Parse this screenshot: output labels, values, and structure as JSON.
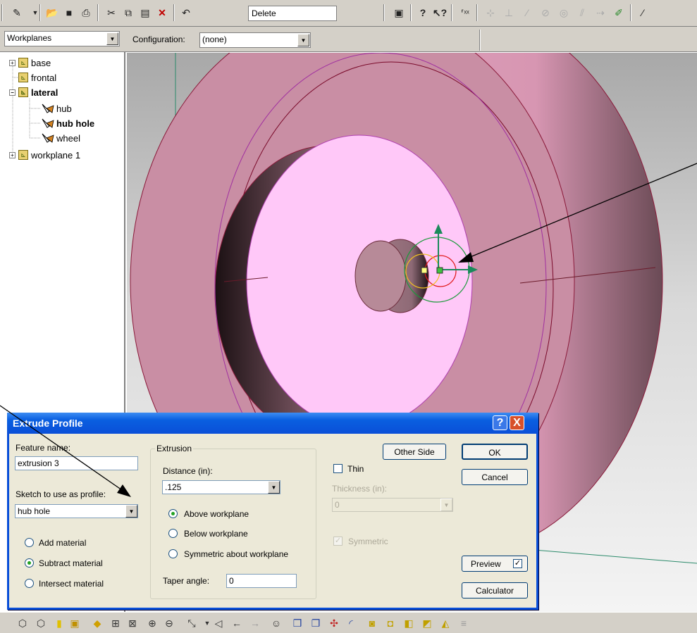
{
  "toolbar": {
    "delete_field": "Delete",
    "icons": [
      "sketch-icon",
      "open-icon",
      "save-icon",
      "print-icon",
      "cut-icon",
      "copy-icon",
      "paste-icon",
      "delete-icon",
      "undo-icon",
      "help-icon",
      "whats-this-icon"
    ]
  },
  "subbar": {
    "workplanes_value": "Workplanes",
    "configuration_label": "Configuration:",
    "configuration_value": "(none)"
  },
  "tree": {
    "items": [
      {
        "label": "base",
        "expander": "+"
      },
      {
        "label": "frontal",
        "expander": ""
      },
      {
        "label": "lateral",
        "expander": "−",
        "bold": true
      },
      {
        "label": "hub"
      },
      {
        "label": "hub hole",
        "bold": true
      },
      {
        "label": "wheel"
      },
      {
        "label": "workplane 1",
        "expander": "+"
      }
    ]
  },
  "dialog": {
    "title": "Extrude Profile",
    "feature_name_label": "Feature name:",
    "feature_name_value": "extrusion 3",
    "sketch_label": "Sketch to use as profile:",
    "sketch_value": "hub hole",
    "material_options": [
      "Add material",
      "Subtract material",
      "Intersect material"
    ],
    "material_selected": "Subtract material",
    "extrusion_group": "Extrusion",
    "distance_label": "Distance (in):",
    "distance_value": ".125",
    "direction_options": [
      "Above workplane",
      "Below workplane",
      "Symmetric about workplane"
    ],
    "direction_selected": "Above workplane",
    "taper_label": "Taper angle:",
    "taper_value": "0",
    "other_side_label": "Other Side",
    "thin_label": "Thin",
    "thin_checked": false,
    "thickness_label": "Thickness (in):",
    "thickness_value": "0",
    "symmetric_label": "Symmetric",
    "symmetric_checked": true,
    "ok_label": "OK",
    "cancel_label": "Cancel",
    "preview_label": "Preview",
    "preview_checked": true,
    "calculator_label": "Calculator",
    "help_button": "?",
    "close_button": "X"
  },
  "colors": {
    "title_bar": "#0a4fd8",
    "model_face": "#e8a5c0",
    "model_inner_face": "#ffc8f8",
    "dialog_bg": "#ece9d8"
  }
}
